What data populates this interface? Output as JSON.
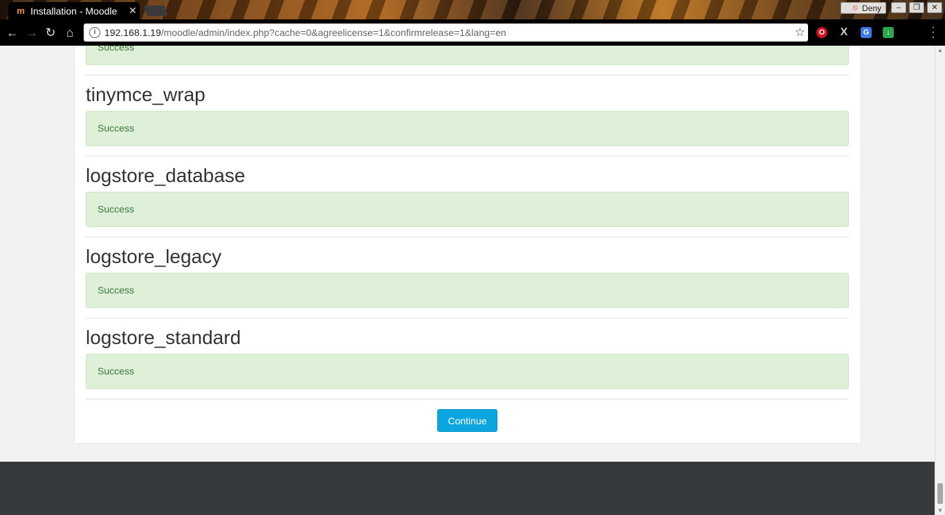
{
  "browser": {
    "tab_title": "Installation - Moodle",
    "tab_close": "✕",
    "favicon": "m",
    "deny_label": "Deny",
    "url_host": "192.168.1.19",
    "url_path": "/moodle/admin/index.php?cache=0&agreelicense=1&confirmrelease=1&lang=en",
    "window_buttons": [
      "–",
      "❐",
      "✕"
    ],
    "extensions": [
      "opera-icon",
      "x-icon",
      "translate-icon",
      "download-icon"
    ]
  },
  "top_partial": {
    "status": "Success"
  },
  "plugins": [
    {
      "name": "tinymce_wrap",
      "status": "Success"
    },
    {
      "name": "logstore_database",
      "status": "Success"
    },
    {
      "name": "logstore_legacy",
      "status": "Success"
    },
    {
      "name": "logstore_standard",
      "status": "Success"
    }
  ],
  "continue_label": "Continue",
  "colors": {
    "success_bg": "#dff0d8",
    "success_text": "#3c763d",
    "button_bg": "#0ba6e0",
    "footer_bg": "#373a3c"
  }
}
